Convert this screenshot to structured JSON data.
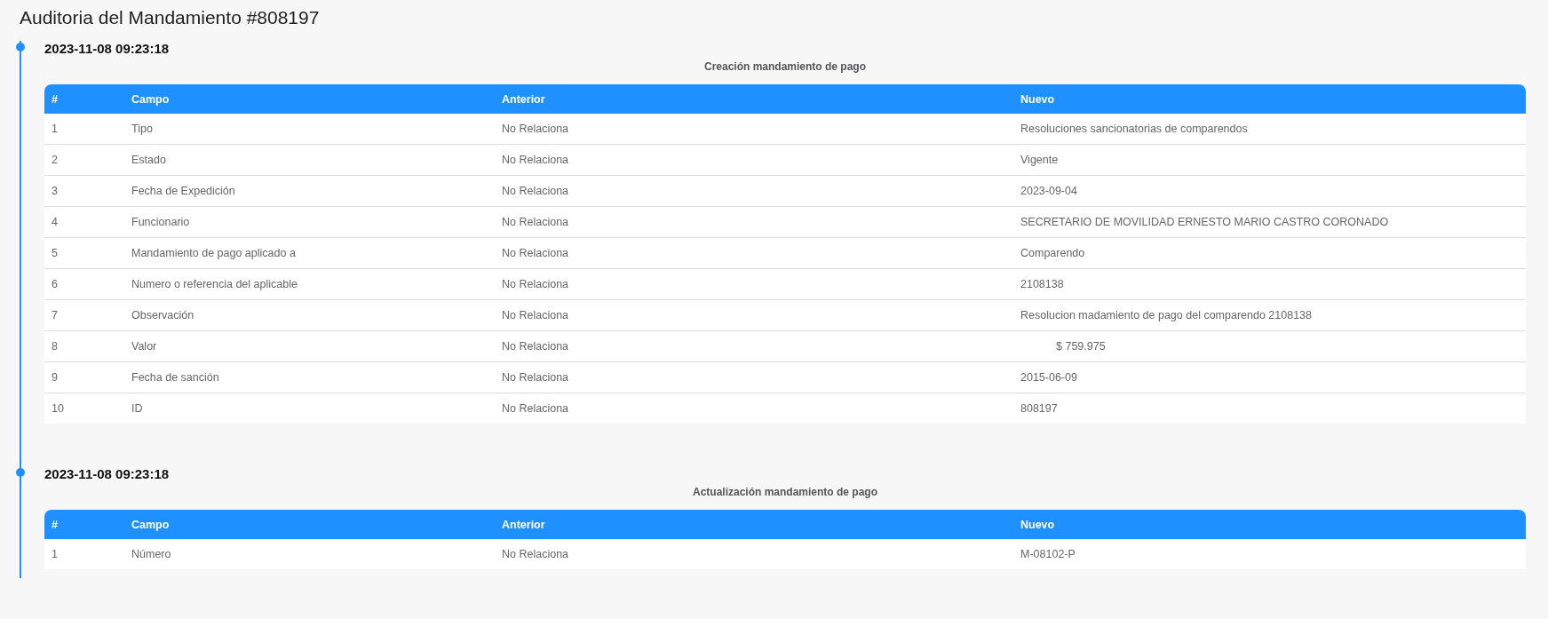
{
  "page_title": "Auditoria del Mandamiento #808197",
  "entries": [
    {
      "timestamp": "2023-11-08 09:23:18",
      "action": "Creación mandamiento de pago",
      "columns": [
        "#",
        "Campo",
        "Anterior",
        "Nuevo"
      ],
      "rows": [
        {
          "kind": "text",
          "index": "1",
          "field": "Tipo",
          "previous": "No Relaciona",
          "new": "Resoluciones sancionatorias de comparendos"
        },
        {
          "kind": "text",
          "index": "2",
          "field": "Estado",
          "previous": "No Relaciona",
          "new": "Vigente"
        },
        {
          "kind": "text",
          "index": "3",
          "field": "Fecha de Expedición",
          "previous": "No Relaciona",
          "new": "2023-09-04"
        },
        {
          "kind": "text",
          "index": "4",
          "field": "Funcionario",
          "previous": "No Relaciona",
          "new": "SECRETARIO DE MOVILIDAD ERNESTO MARIO CASTRO CORONADO"
        },
        {
          "kind": "text",
          "index": "5",
          "field": "Mandamiento de pago aplicado a",
          "previous": "No Relaciona",
          "new": "Comparendo"
        },
        {
          "kind": "text",
          "index": "6",
          "field": "Numero o referencia del aplicable",
          "previous": "No Relaciona",
          "new": "2108138"
        },
        {
          "kind": "text",
          "index": "7",
          "field": "Observación",
          "previous": "No Relaciona",
          "new": "Resolucion madamiento de pago del comparendo 2108138"
        },
        {
          "kind": "currency",
          "index": "8",
          "field": "Valor",
          "previous": "No Relaciona",
          "new": "$ 759.975"
        },
        {
          "kind": "text",
          "index": "9",
          "field": "Fecha de sanción",
          "previous": "No Relaciona",
          "new": "2015-06-09"
        },
        {
          "kind": "text",
          "index": "10",
          "field": "ID",
          "previous": "No Relaciona",
          "new": "808197"
        }
      ]
    },
    {
      "timestamp": "2023-11-08 09:23:18",
      "action": "Actualización mandamiento de pago",
      "columns": [
        "#",
        "Campo",
        "Anterior",
        "Nuevo"
      ],
      "rows": [
        {
          "kind": "text",
          "index": "1",
          "field": "Número",
          "previous": "No Relaciona",
          "new": "M-08102-P"
        }
      ]
    }
  ]
}
